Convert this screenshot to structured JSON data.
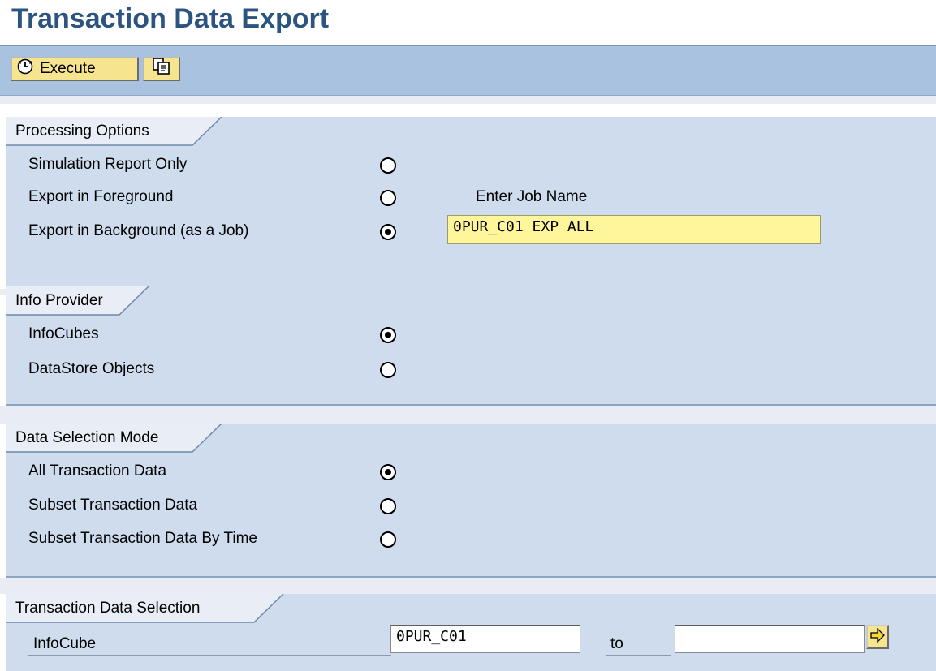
{
  "page": {
    "title": "Transaction Data Export"
  },
  "toolbar": {
    "execute_label": "Execute",
    "execute_icon": "execute-clock-icon",
    "copy_icon": "copy-variant-icon"
  },
  "processing_options": {
    "heading": "Processing Options",
    "options": [
      {
        "label": "Simulation Report Only",
        "selected": false
      },
      {
        "label": "Export in Foreground",
        "selected": false
      },
      {
        "label": "Export in Background (as a Job)",
        "selected": true
      }
    ],
    "job_name_label": "Enter Job Name",
    "job_name_value": "0PUR_C01 EXP ALL"
  },
  "info_provider": {
    "heading": "Info Provider",
    "options": [
      {
        "label": "InfoCubes",
        "selected": true
      },
      {
        "label": "DataStore Objects",
        "selected": false
      }
    ]
  },
  "data_selection_mode": {
    "heading": "Data Selection Mode",
    "options": [
      {
        "label": "All Transaction Data",
        "selected": true
      },
      {
        "label": "Subset Transaction Data",
        "selected": false
      },
      {
        "label": "Subset Transaction Data By Time",
        "selected": false
      }
    ]
  },
  "transaction_data_selection": {
    "heading": "Transaction Data Selection",
    "field_label": "InfoCube",
    "from_value": "0PUR_C01",
    "to_label": "to",
    "to_value": "",
    "multiple_selection_icon": "arrow-right-icon"
  },
  "colors": {
    "title": "#2c5480",
    "toolbar": "#a8c2e0",
    "section": "#cfdcee",
    "button": "#f6e58e",
    "highlight_input": "#fff59a"
  }
}
